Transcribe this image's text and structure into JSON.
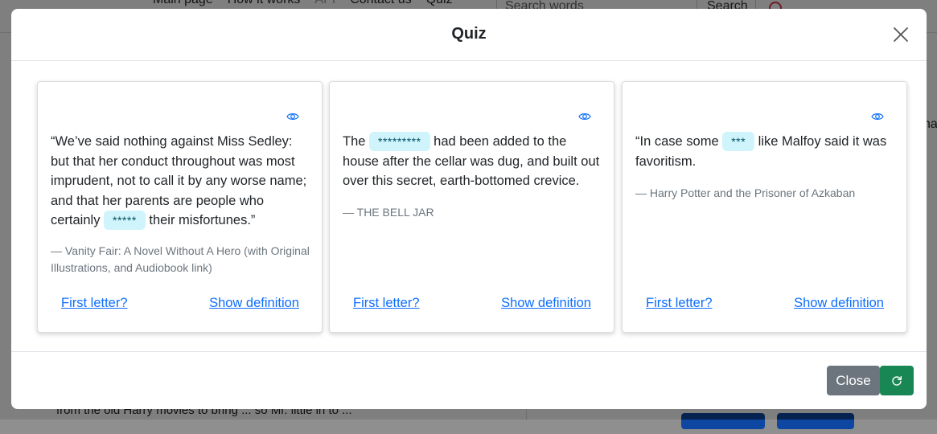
{
  "background": {
    "nav": [
      "Main page",
      "How it works",
      "API",
      "Contact us",
      "Quiz"
    ],
    "search_placeholder": "Search words",
    "search_button": "Search",
    "left_panel_text": "from the old Harry movies to bring ... so Mr. little in to ... ",
    "right_text": "ha"
  },
  "modal": {
    "title": "Quiz",
    "close_label": "Close",
    "cards": [
      {
        "quote_before": "“We’ve said nothing against Miss Sedley: but that her conduct throughout was most imprudent, not to call it by any worse name; and that her parents are people who certainly ",
        "blank": "*****",
        "quote_after": " their misfortunes.”",
        "source": "— Vanity Fair: A Novel Without A Hero (with Original Illustrations, and Audiobook link)",
        "first_letter": "First letter?",
        "show_definition": "Show definition"
      },
      {
        "quote_before": "The ",
        "blank": "*********",
        "quote_after": " had been added to the house after the cellar was dug, and built out over this secret, earth-bottomed crevice.",
        "source": "— THE BELL JAR",
        "first_letter": "First letter?",
        "show_definition": "Show definition"
      },
      {
        "quote_before": "“In case some ",
        "blank": "***",
        "quote_after": " like Malfoy said it was favoritism.",
        "source": "— Harry Potter and the Prisoner of Azkaban",
        "first_letter": "First letter?",
        "show_definition": "Show definition"
      }
    ]
  },
  "colors": {
    "link": "#0d6efd",
    "blank_bg": "#cff4fc",
    "close_button": "#6c757d",
    "refresh_button": "#198754"
  },
  "icons": [
    "close-icon",
    "eye-icon",
    "refresh-icon"
  ]
}
